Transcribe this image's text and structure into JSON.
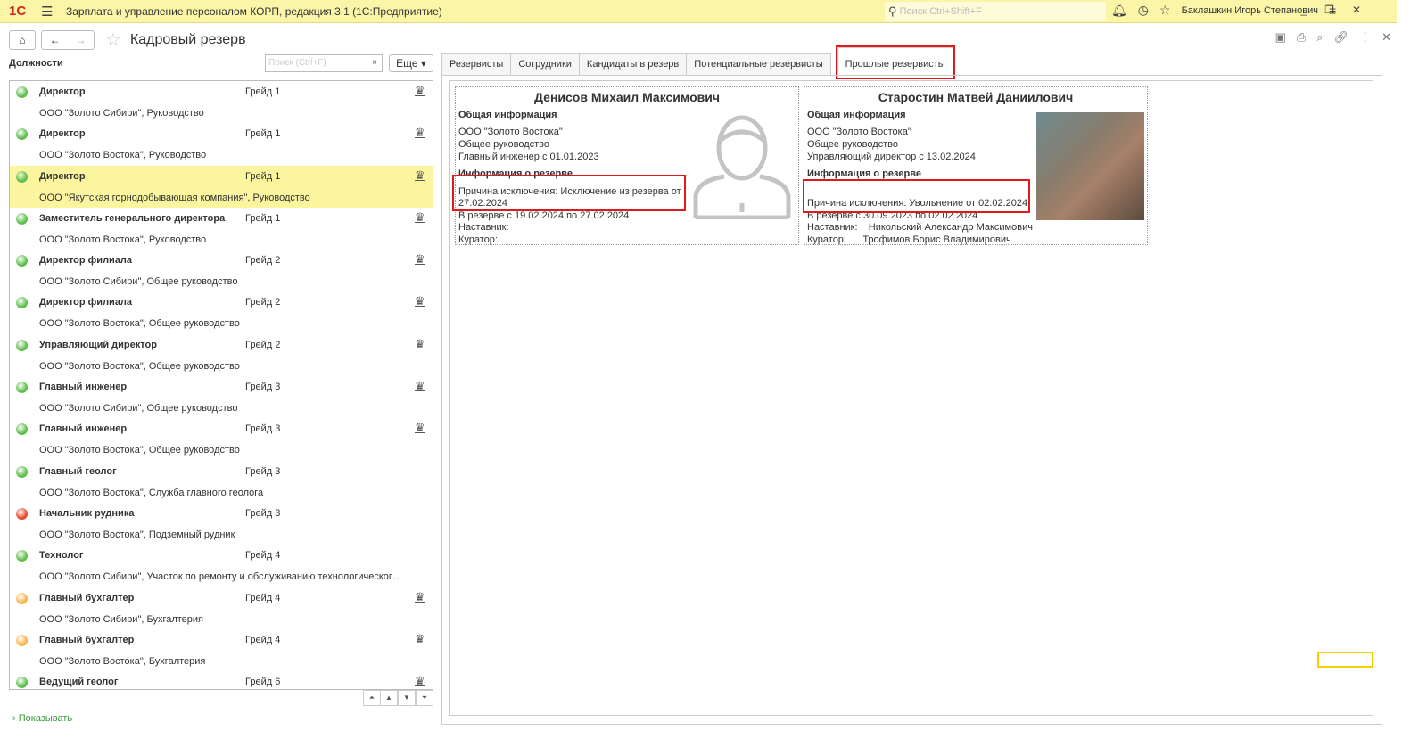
{
  "titlebar": {
    "logo": "1С",
    "title": "Зарплата и управление персоналом КОРП, редакция 3.1  (1С:Предприятие)",
    "search_placeholder": "Поиск Ctrl+Shift+F",
    "user": "Баклашкин Игорь Степанович"
  },
  "page": {
    "title": "Кадровый резерв"
  },
  "left": {
    "header": "Должности",
    "search_placeholder": "Поиск (Ctrl+F)",
    "clear": "×",
    "more": "Еще ▾",
    "show_link": "Показывать",
    "items": [
      {
        "name": "Директор",
        "grade": "Грейд 1",
        "org": "ООО \"Золото Сибири\", Руководство",
        "status": "green",
        "crown": true
      },
      {
        "name": "Директор",
        "grade": "Грейд 1",
        "org": "ООО \"Золото Востока\", Руководство",
        "status": "green",
        "crown": true
      },
      {
        "name": "Директор",
        "grade": "Грейд 1",
        "org": "ООО \"Якутская горнодобывающая компания\", Руководство",
        "status": "green",
        "crown": true,
        "selected": true
      },
      {
        "name": "Заместитель генерального директора",
        "grade": "Грейд 1",
        "org": "ООО \"Золото Востока\", Руководство",
        "status": "green",
        "crown": true
      },
      {
        "name": "Директор филиала",
        "grade": "Грейд 2",
        "org": "ООО \"Золото Сибири\", Общее руководство",
        "status": "green",
        "crown": true
      },
      {
        "name": "Директор филиала",
        "grade": "Грейд 2",
        "org": "ООО \"Золото Востока\", Общее руководство",
        "status": "green",
        "crown": true
      },
      {
        "name": "Управляющий директор",
        "grade": "Грейд 2",
        "org": "ООО \"Золото Востока\", Общее руководство",
        "status": "green",
        "crown": true
      },
      {
        "name": "Главный инженер",
        "grade": "Грейд 3",
        "org": "ООО \"Золото Сибири\", Общее руководство",
        "status": "green",
        "crown": true
      },
      {
        "name": "Главный инженер",
        "grade": "Грейд 3",
        "org": "ООО \"Золото Востока\", Общее руководство",
        "status": "green",
        "crown": true
      },
      {
        "name": "Главный геолог",
        "grade": "Грейд 3",
        "org": "ООО \"Золото Востока\", Служба главного геолога",
        "status": "green",
        "crown": false
      },
      {
        "name": "Начальник рудника",
        "grade": "Грейд 3",
        "org": "ООО \"Золото Востока\", Подземный рудник",
        "status": "red",
        "crown": false
      },
      {
        "name": "Технолог",
        "grade": "Грейд 4",
        "org": "ООО \"Золото Сибири\", Участок по ремонту и обслуживанию технологического о...",
        "status": "green",
        "crown": false
      },
      {
        "name": "Главный бухгалтер",
        "grade": "Грейд 4",
        "org": "ООО \"Золото Сибири\", Бухгалтерия",
        "status": "orange",
        "crown": true
      },
      {
        "name": "Главный бухгалтер",
        "grade": "Грейд 4",
        "org": "ООО \"Золото Востока\", Бухгалтерия",
        "status": "orange",
        "crown": true
      },
      {
        "name": "Ведущий геолог",
        "grade": "Грейд 6",
        "org": "",
        "status": "green",
        "crown": true
      }
    ]
  },
  "colors": {
    "green": "#5cbf4a",
    "red": "#e8462c",
    "orange": "#f7b54a",
    "selected": "#fbf59f",
    "highlight": "#e0191c"
  },
  "tabs": [
    "Резервисты",
    "Сотрудники",
    "Кандидаты в резерв",
    "Потенциальные резервисты",
    "Прошлые резервисты"
  ],
  "cards": [
    {
      "name": "Денисов Михаил Максимович",
      "general": "Общая информация",
      "org": "ООО \"Золото Востока\"",
      "dept": "Общее руководство",
      "position": "Главный инженер с 01.01.2023",
      "reserve": "Информация о резерве",
      "reason1": "Причина исключения: Исключение из резерва от",
      "reason2": "27.02.2024",
      "period": "В резерве с 19.02.2024 по 27.02.2024",
      "mentor_label": "Наставник:",
      "mentor": "",
      "curator_label": "Куратор:",
      "curator": "",
      "photo": "placeholder-avatar"
    },
    {
      "name": "Старостин Матвей Даниилович",
      "general": "Общая информация",
      "org": "ООО \"Золото Востока\"",
      "dept": "Общее руководство",
      "position": "Управляющий директор с 13.02.2024",
      "reserve": "Информация о резерве",
      "reason1": "Причина исключения: Увольнение от 02.02.2024",
      "period": "В резерве с 30.09.2023 по 02.02.2024",
      "mentor_label": "Наставник:",
      "mentor": "Никольский Александр Максимович",
      "curator_label": "Куратор:",
      "curator": "Трофимов Борис Владимирович",
      "photo": "person-photo"
    }
  ]
}
